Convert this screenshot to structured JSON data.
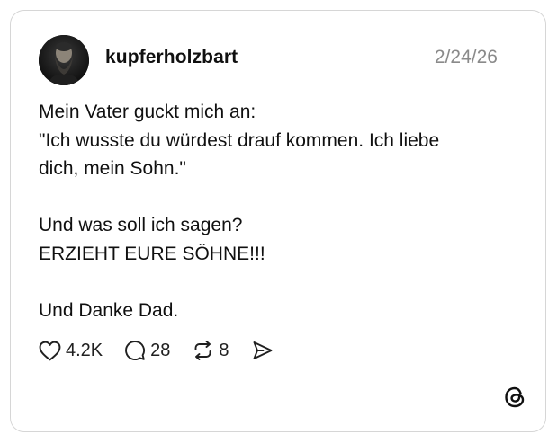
{
  "post": {
    "username": "kupferholzbart",
    "date": "2/24/26",
    "lines": [
      "Mein Vater guckt mich an:",
      "\"Ich wusste du würdest drauf kommen. Ich liebe",
      "dich, mein Sohn.\"",
      "Und was soll ich sagen?",
      "ERZIEHT EURE SÖHNE!!!",
      "Und Danke Dad."
    ]
  },
  "actions": {
    "likes": "4.2K",
    "replies": "28",
    "reposts": "8",
    "icons": [
      "heart-icon",
      "comment-icon",
      "repost-icon",
      "share-icon"
    ]
  },
  "brand": {
    "logo": "threads-icon"
  },
  "colors": {
    "text": "#101010",
    "muted": "#8a8a8a",
    "border": "#d6d6d6"
  }
}
